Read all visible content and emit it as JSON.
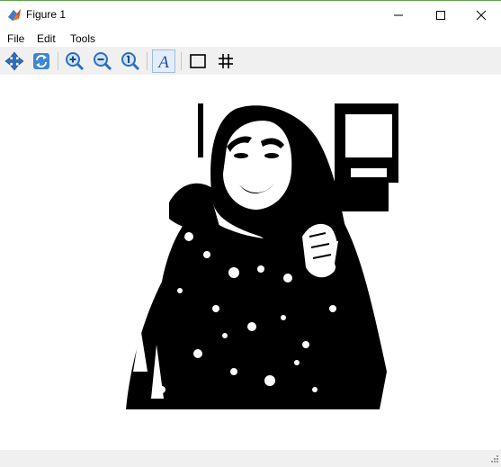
{
  "window": {
    "title": "Figure 1",
    "app_icon": "matlab-membrane-icon"
  },
  "window_controls": {
    "minimize": "minimize-icon",
    "maximize": "maximize-icon",
    "close": "close-icon"
  },
  "menu": {
    "items": [
      {
        "label": "File"
      },
      {
        "label": "Edit"
      },
      {
        "label": "Tools"
      }
    ]
  },
  "toolbar": {
    "tools": [
      {
        "icon": "pan-icon"
      },
      {
        "icon": "rotate-icon"
      },
      {
        "icon": "zoom-in-icon"
      },
      {
        "icon": "zoom-out-icon"
      },
      {
        "icon": "zoom-reset-icon"
      },
      {
        "icon": "text-icon"
      },
      {
        "icon": "box-icon"
      },
      {
        "icon": "grid-icon"
      }
    ],
    "accent": "#2a6fbe"
  },
  "figure": {
    "content": "binary-thresholded-portrait-image"
  }
}
